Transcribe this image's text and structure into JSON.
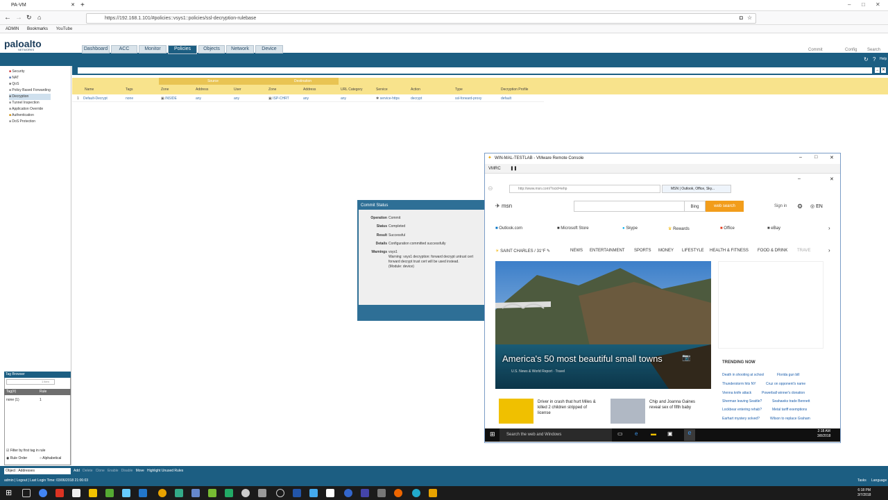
{
  "browser": {
    "tab_title": "PA-VM",
    "url": "https://192.168.1.101/#policies::vsys1::policies/ssl-decryption-rulebase",
    "bookmarks": [
      "ADMIN",
      "Bookmarks",
      "YouTube"
    ]
  },
  "pa": {
    "logo": "paloalto",
    "logo_sub": "NETWORKS",
    "nav_tabs": [
      "Dashboard",
      "ACC",
      "Monitor",
      "Policies",
      "Objects",
      "Network",
      "Device"
    ],
    "active_tab": "Policies",
    "top_right": [
      "Commit",
      "Config",
      "Search"
    ],
    "help": "Help",
    "items_count": "1 item",
    "tree": [
      "Security",
      "NAT",
      "QoS",
      "Policy Based Forwarding",
      "Decryption",
      "Tunnel Inspection",
      "Application Override",
      "Authentication",
      "DoS Protection"
    ],
    "group_headers": {
      "source": "Source",
      "destination": "Destination"
    },
    "columns": [
      "Name",
      "Tags",
      "Zone",
      "Address",
      "User",
      "Zone",
      "Address",
      "URL Category",
      "Service",
      "Action",
      "Type",
      "Decryption Profile"
    ],
    "row": {
      "num": "1",
      "name": "Default-Decrypt",
      "tags": "none",
      "src_zone": "INSIDE",
      "src_addr": "any",
      "user": "any",
      "dst_zone": "ISP-CHRT",
      "dst_addr": "any",
      "url_cat": "any",
      "service": "service-https",
      "action": "decrypt",
      "type": "ssl-forward-proxy",
      "profile": "default"
    },
    "tag_browser": {
      "title": "Tag Browser",
      "count": "1 item",
      "col_tag": "Tag(#)",
      "col_rule": "Rule",
      "row_tag": "none (1)",
      "row_rule": "1",
      "filter_label": "Filter by first tag in rule",
      "rule_order": "Rule Order",
      "alphabetical": "Alphabetical"
    },
    "bottom": {
      "object_label": "Object : Addresses",
      "actions": [
        "Add",
        "Delete",
        "Clone",
        "Enable",
        "Disable",
        "Move",
        "Highlight Unused Rules"
      ],
      "status": "admin | Logout | Last Login Time: 03/06/2018 21:06:03",
      "tasks": "Tasks",
      "language": "Language"
    }
  },
  "commit_status": {
    "title": "Commit Status",
    "operation_label": "Operation",
    "operation": "Commit",
    "status_label": "Status",
    "status": "Completed",
    "result_label": "Result",
    "result": "Successful",
    "details_label": "Details",
    "details": "Configuration committed successfully",
    "warnings_label": "Warnings",
    "warnings_1": "vsys1",
    "warnings_2": "Warning: vsys1 decryption: forward decrypt untrust cert",
    "warnings_3": "forward decrypt trust cert will be used instead.",
    "warnings_4": "(Module: device)"
  },
  "vmrc": {
    "title": "WIN-MAL-TESTLAB - VMware Remote Console",
    "menu": "VMRC",
    "ie": {
      "address": "http://www.msn.com/?ocid=iehp",
      "tab": "MSN | Outlook, Office, Sky..."
    },
    "msn": {
      "logo": "msn",
      "bing": "Bing",
      "web_search": "web search",
      "sign_in": "Sign in",
      "lang": "EN",
      "quick_links": [
        "Outlook.com",
        "Microsoft Store",
        "Skype",
        "Rewards",
        "Office",
        "eBay"
      ],
      "location": "SAINT CHARLES / 31°F",
      "categories": [
        "NEWS",
        "ENTERTAINMENT",
        "SPORTS",
        "MONEY",
        "LIFESTYLE",
        "HEALTH & FITNESS",
        "FOOD & DRINK",
        "TRAVE"
      ],
      "hero_title": "America's 50 most beautiful small towns",
      "hero_source": "U.S. News & World Report · Travel",
      "trending_title": "TRENDING NOW",
      "trending": [
        [
          "Death in shooting at school",
          "Florida gun bill"
        ],
        [
          "Thunderstorm hits NY",
          "Cruz on opponent's name"
        ],
        [
          "Vienna knife attack",
          "Powerball winner's donation"
        ],
        [
          "Sherman leaving Seattle?",
          "Seahawks trade Bennett"
        ],
        [
          "Lockbear entering rehab?",
          "Metal tariff exemptions"
        ],
        [
          "Earhart mystery solved?",
          "Wilson to replace Graham"
        ]
      ],
      "story1": "Driver in crash that hurt Miles & killed 2 children stripped of license",
      "story2": "Chip and Joanna Gaines reveal sex of fifth baby"
    },
    "win_search": "Search the web and Windows",
    "win_time": "2:18 AM",
    "win_date": "3/8/2018"
  },
  "host_taskbar": {
    "time": "6:18 PM",
    "date": "3/7/2018"
  },
  "colors": {
    "pa_blue": "#1c5e82",
    "header_yellow": "#f8e38c",
    "websearch_orange": "#f29d1b"
  }
}
